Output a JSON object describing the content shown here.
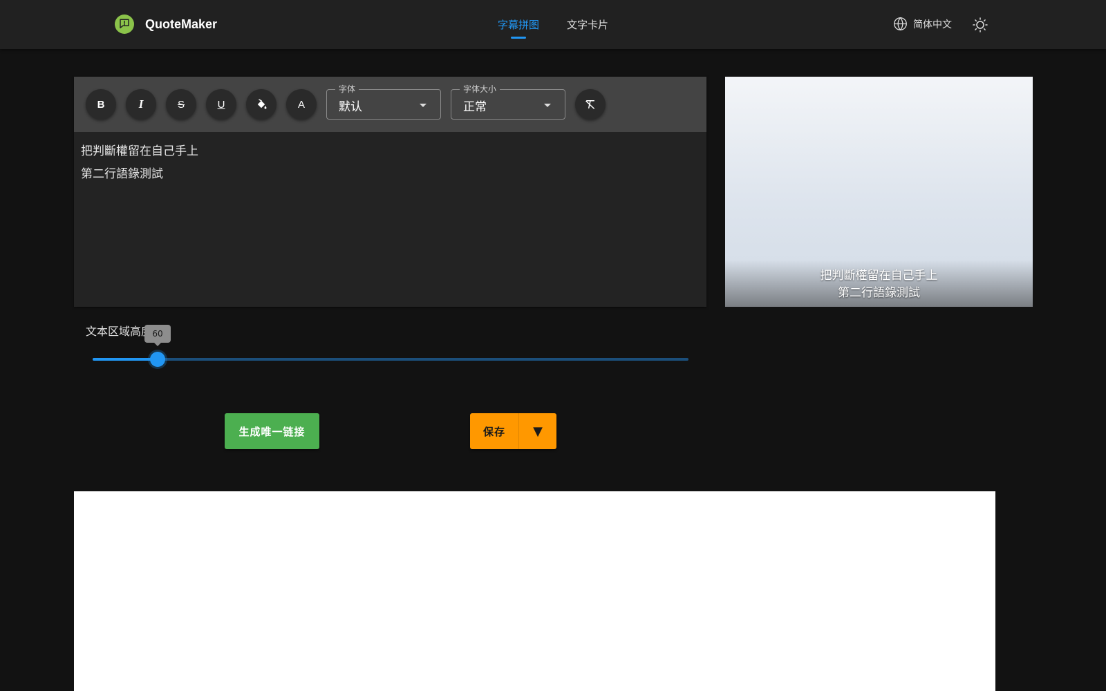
{
  "header": {
    "app_name": "QuoteMaker",
    "tabs": [
      {
        "label": "字幕拼图",
        "active": true
      },
      {
        "label": "文字卡片",
        "active": false
      }
    ],
    "language": "简体中文",
    "logo_icon": "chat-bubble-icon",
    "theme_icon": "sun-icon"
  },
  "toolbar": {
    "bold": "B",
    "italic": "I",
    "strike": "S",
    "underline": "U",
    "text_color": "A",
    "font": {
      "label": "字体",
      "value": "默认"
    },
    "font_size": {
      "label": "字体大小",
      "value": "正常"
    }
  },
  "editor": {
    "lines": [
      "把判斷權留在自己手上",
      "第二行語錄測試"
    ]
  },
  "preview": {
    "lines": [
      "把判斷權留在自己手上",
      "第二行語錄測試"
    ]
  },
  "slider": {
    "label": "文本区域高度",
    "value": 60,
    "value_text": "60",
    "min": 0,
    "max": 550
  },
  "actions": {
    "generate_link": "生成唯一链接",
    "save": "保存",
    "save_menu": "▼"
  },
  "colors": {
    "accent": "#2196f3",
    "generate": "#4caf50",
    "save": "#ff9800",
    "background": "#121212",
    "header": "#212121"
  }
}
